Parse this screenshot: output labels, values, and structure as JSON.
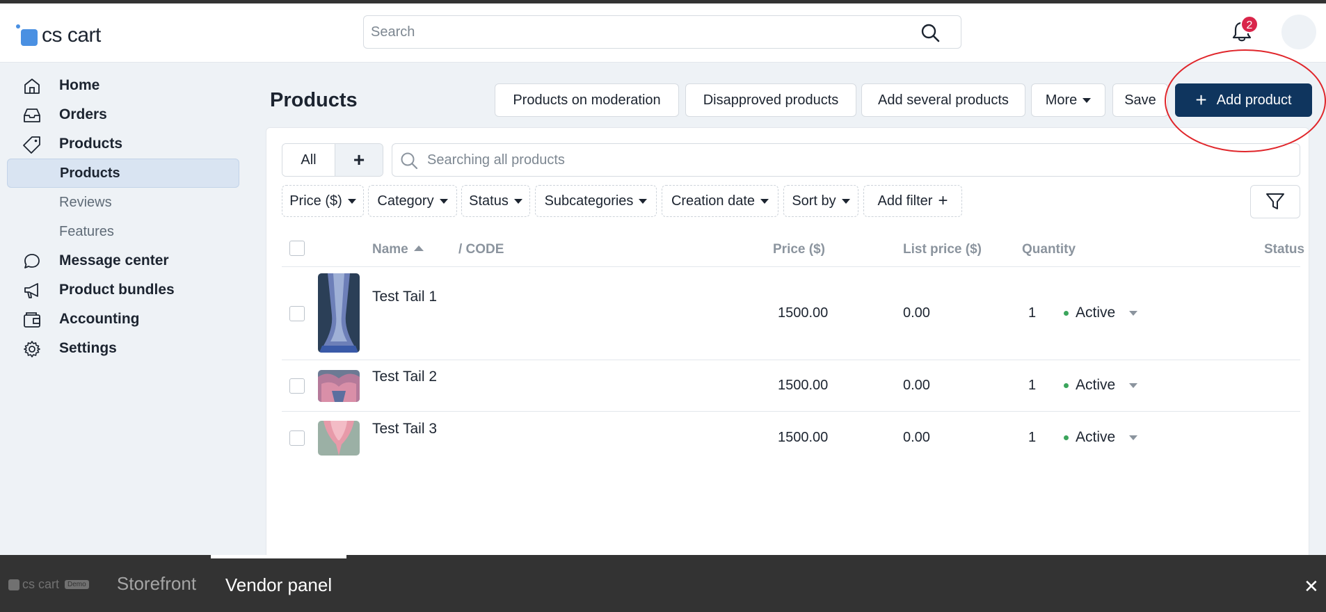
{
  "header": {
    "logo_text": "cs cart",
    "search_placeholder": "Search",
    "notifications_count": "2"
  },
  "sidebar": {
    "items": [
      {
        "label": "Home",
        "icon": "home-icon"
      },
      {
        "label": "Orders",
        "icon": "inbox-icon"
      },
      {
        "label": "Products",
        "icon": "tag-icon"
      },
      {
        "label": "Products",
        "sub": true,
        "active": true
      },
      {
        "label": "Reviews",
        "sub": true
      },
      {
        "label": "Features",
        "sub": true
      },
      {
        "label": "Message center",
        "icon": "chat-icon"
      },
      {
        "label": "Product bundles",
        "icon": "megaphone-icon"
      },
      {
        "label": "Accounting",
        "icon": "wallet-icon"
      },
      {
        "label": "Settings",
        "icon": "gear-icon"
      }
    ]
  },
  "page": {
    "title": "Products",
    "toolbar": {
      "moderation": "Products on moderation",
      "disapproved": "Disapproved products",
      "add_several": "Add several products",
      "more": "More",
      "save": "Save",
      "add_product": "Add product"
    }
  },
  "tabs": {
    "all": "All",
    "add": "+"
  },
  "product_search": {
    "placeholder": "Searching all products"
  },
  "filters": {
    "price": "Price ($)",
    "category": "Category",
    "status": "Status",
    "subcategories": "Subcategories",
    "creation_date": "Creation date",
    "sort_by": "Sort by",
    "add_filter": "Add filter"
  },
  "table": {
    "columns": {
      "name": "Name",
      "code": "/  CODE",
      "price": "Price ($)",
      "list_price": "List price ($)",
      "quantity": "Quantity",
      "status": "Status"
    },
    "rows": [
      {
        "name": "Test Tail 1",
        "price": "1500.00",
        "list_price": "0.00",
        "quantity": "1",
        "status": "Active"
      },
      {
        "name": "Test Tail 2",
        "price": "1500.00",
        "list_price": "0.00",
        "quantity": "1",
        "status": "Active"
      },
      {
        "name": "Test Tail 3",
        "price": "1500.00",
        "list_price": "0.00",
        "quantity": "1",
        "status": "Active"
      }
    ]
  },
  "bottom_bar": {
    "logo_text": "cs cart",
    "demo_badge": "Demo",
    "storefront": "Storefront",
    "vendor_panel": "Vendor panel",
    "close": "✕"
  },
  "colors": {
    "primary": "#0f355e",
    "active_nav": "#d9e4f2",
    "badge": "#d9254a",
    "status_active": "#3ba55c",
    "highlight_ring": "#e0262b"
  }
}
